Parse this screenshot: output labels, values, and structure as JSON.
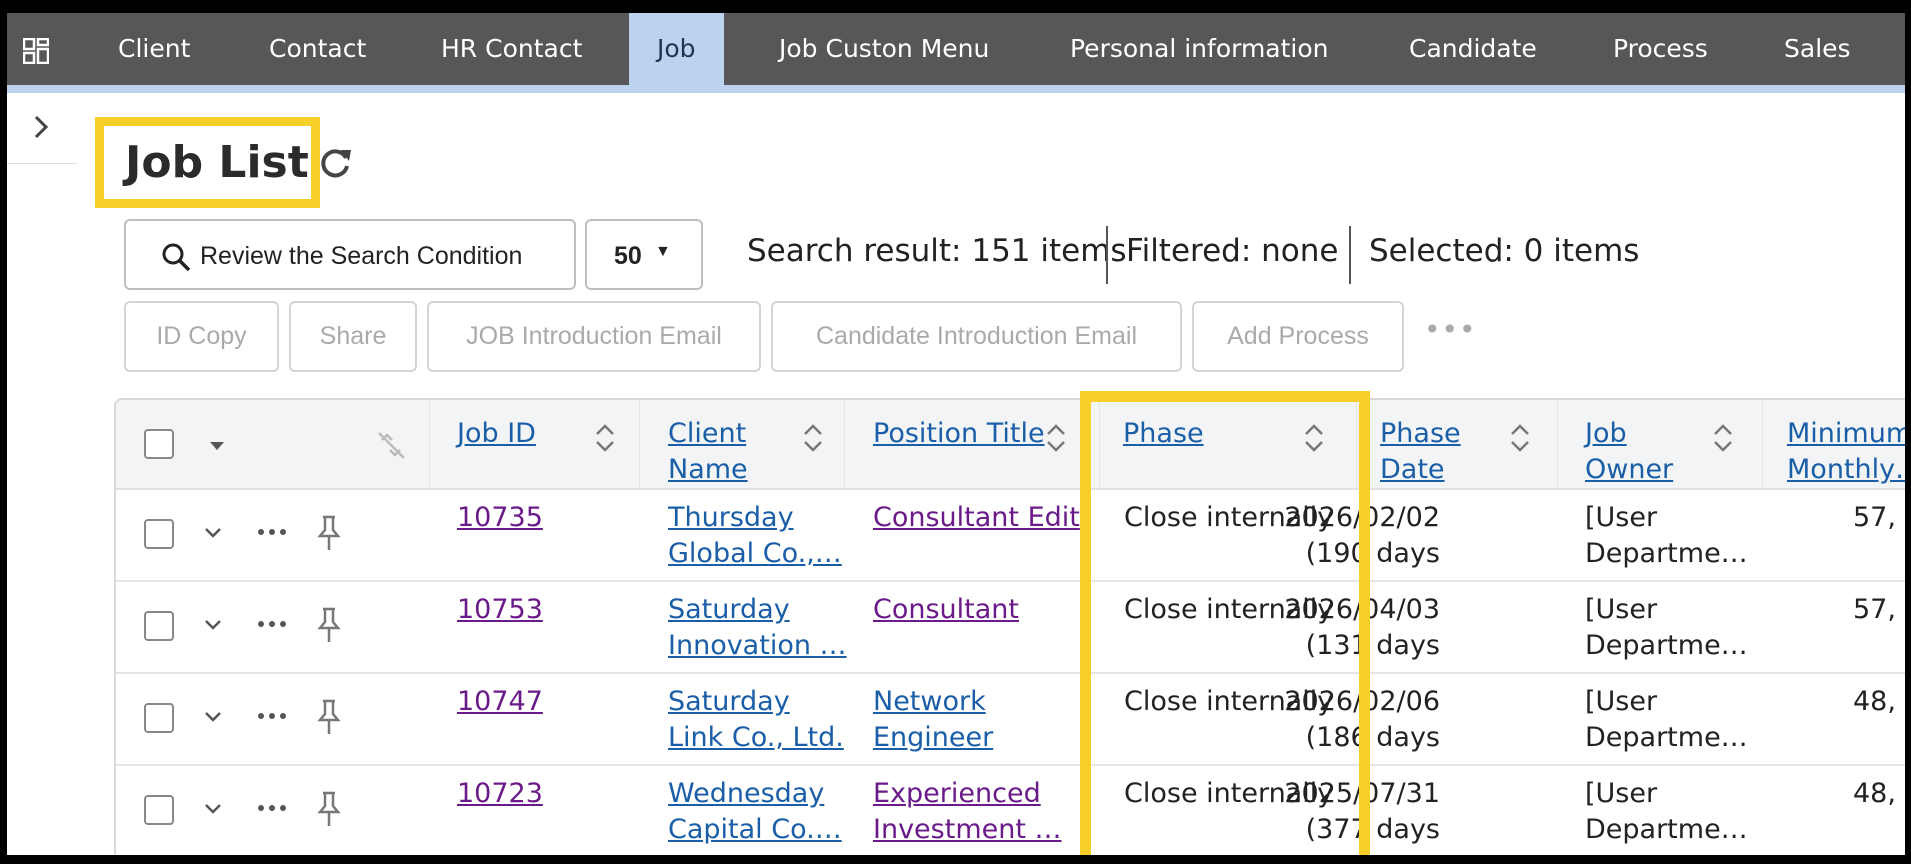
{
  "nav": {
    "tabs": [
      "Client",
      "Contact",
      "HR Contact",
      "Job",
      "Job Custon Menu",
      "Personal information",
      "Candidate",
      "Process",
      "Sales"
    ],
    "active": "Job"
  },
  "page": {
    "title": "Job List"
  },
  "search": {
    "review_label": "Review the Search Condition",
    "page_size": "50",
    "result": "Search result: 151 items",
    "filtered": "Filtered: none",
    "selected": "Selected:  0 items"
  },
  "actions": [
    "ID Copy",
    "Share",
    "JOB Introduction Email",
    "Candidate Introduction Email",
    "Add Process"
  ],
  "table": {
    "headers": {
      "job_id": "Job ID",
      "client_name": [
        "Client ",
        "Name"
      ],
      "position_title": "Position Title",
      "phase": "Phase",
      "phase_date": [
        "Phase ",
        "Date"
      ],
      "job_owner": [
        "Job ",
        "Owner"
      ],
      "min_monthly": [
        "Minimum ",
        "Monthly…"
      ]
    },
    "rows": [
      {
        "job_id": "10735",
        "client": [
          "Thursday ",
          "Global Co.,…"
        ],
        "position": [
          "Consultant Edit"
        ],
        "position_visited": true,
        "phase": "Close internally",
        "date": [
          "2026/02/02",
          "(190 days"
        ],
        "owner": [
          "[User ",
          "Departme…"
        ],
        "min": "57,"
      },
      {
        "job_id": "10753",
        "client": [
          "Saturday ",
          "Innovation …"
        ],
        "position": [
          "Consultant"
        ],
        "position_visited": true,
        "phase": "Close internally",
        "date": [
          "2026/04/03",
          "(131 days"
        ],
        "owner": [
          "[User ",
          "Departme…"
        ],
        "min": "57,"
      },
      {
        "job_id": "10747",
        "client": [
          "Saturday ",
          "Link Co., Ltd."
        ],
        "position": [
          "Network ",
          "Engineer"
        ],
        "position_visited": false,
        "phase": "Close internally",
        "date": [
          "2026/02/06",
          "(186 days"
        ],
        "owner": [
          "[User ",
          "Departme…"
        ],
        "min": "48,"
      },
      {
        "job_id": "10723",
        "client": [
          "Wednesday ",
          "Capital Co.…"
        ],
        "position": [
          "Experienced ",
          "Investment …"
        ],
        "position_visited": true,
        "phase": "Close internally",
        "date": [
          "2025/07/31",
          "(377 days"
        ],
        "owner": [
          "[User ",
          "Departme…"
        ],
        "min": "48,"
      }
    ]
  },
  "colors": {
    "nav_bg": "#575757",
    "active_tab": "#bcd3ef",
    "highlight": "#f7cf2a",
    "link": "#1a5ea8",
    "visited": "#6b1a8a"
  }
}
